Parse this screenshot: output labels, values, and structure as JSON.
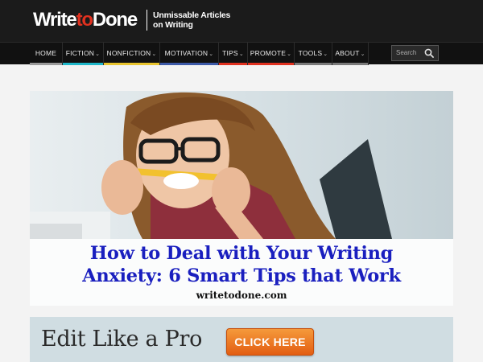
{
  "header": {
    "logo_write": "Write",
    "logo_to": "to",
    "logo_done": "Done",
    "tagline_line1": "Unmissable Articles",
    "tagline_line2": "on Writing"
  },
  "nav": {
    "items": [
      {
        "label": "HOME",
        "has_dropdown": false,
        "accent": "#9a9a9a"
      },
      {
        "label": "FICTION",
        "has_dropdown": true,
        "accent": "#1fb7c9"
      },
      {
        "label": "NONFICTION",
        "has_dropdown": true,
        "accent": "#e8c42e"
      },
      {
        "label": "MOTIVATION",
        "has_dropdown": true,
        "accent": "#3d5aa8"
      },
      {
        "label": "TIPS",
        "has_dropdown": true,
        "accent": "#e0311f"
      },
      {
        "label": "PROMOTE",
        "has_dropdown": true,
        "accent": "#e0311f"
      },
      {
        "label": "TOOLS",
        "has_dropdown": true,
        "accent": "#7a7a7a"
      },
      {
        "label": "ABOUT",
        "has_dropdown": true,
        "accent": "#7a7a7a"
      }
    ],
    "chevron": "⌄"
  },
  "search": {
    "placeholder": "Search",
    "icon": "search-icon"
  },
  "hero": {
    "title_line1": "How to Deal with Your Writing",
    "title_line2": "Anxiety: 6 Smart Tips that Work",
    "domain": "writetodone.com"
  },
  "ad": {
    "text": "Edit Like a Pro",
    "button_label": "CLICK HERE"
  }
}
